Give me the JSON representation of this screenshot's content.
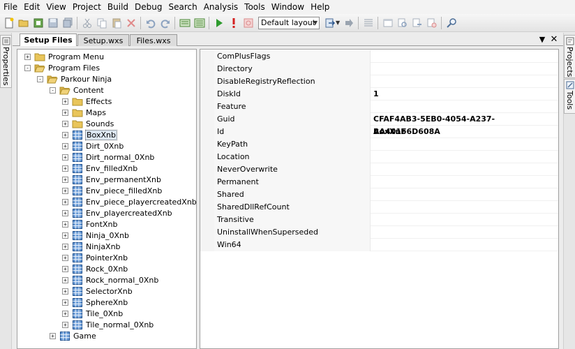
{
  "menu": [
    "File",
    "Edit",
    "View",
    "Project",
    "Build",
    "Debug",
    "Search",
    "Analysis",
    "Tools",
    "Window",
    "Help"
  ],
  "toolbar": {
    "layout_value": "Default layout"
  },
  "left_strip": {
    "properties_label": "Properties"
  },
  "right_strip": {
    "projects_label": "Projects",
    "tools_label": "Tools"
  },
  "tabs": [
    {
      "label": "Setup Files",
      "active": true
    },
    {
      "label": "Setup.wxs",
      "active": false
    },
    {
      "label": "Files.wxs",
      "active": false
    }
  ],
  "tree": [
    {
      "label": "Program Menu",
      "depth": 0,
      "icon": "folder-icon",
      "expander": "+"
    },
    {
      "label": "Program Files",
      "depth": 0,
      "icon": "folder-open-icon",
      "expander": "-"
    },
    {
      "label": "Parkour Ninja",
      "depth": 1,
      "icon": "folder-open-icon",
      "expander": "-"
    },
    {
      "label": "Content",
      "depth": 2,
      "icon": "folder-open-icon",
      "expander": "-"
    },
    {
      "label": "Effects",
      "depth": 3,
      "icon": "folder-icon",
      "expander": "+"
    },
    {
      "label": "Maps",
      "depth": 3,
      "icon": "folder-icon",
      "expander": "+"
    },
    {
      "label": "Sounds",
      "depth": 3,
      "icon": "folder-icon",
      "expander": "+"
    },
    {
      "label": "BoxXnb",
      "depth": 3,
      "icon": "component-icon",
      "expander": "+",
      "selected": true
    },
    {
      "label": "Dirt_0Xnb",
      "depth": 3,
      "icon": "component-icon",
      "expander": "+"
    },
    {
      "label": "Dirt_normal_0Xnb",
      "depth": 3,
      "icon": "component-icon",
      "expander": "+"
    },
    {
      "label": "Env_filledXnb",
      "depth": 3,
      "icon": "component-icon",
      "expander": "+"
    },
    {
      "label": "Env_permanentXnb",
      "depth": 3,
      "icon": "component-icon",
      "expander": "+"
    },
    {
      "label": "Env_piece_filledXnb",
      "depth": 3,
      "icon": "component-icon",
      "expander": "+"
    },
    {
      "label": "Env_piece_playercreatedXnb",
      "depth": 3,
      "icon": "component-icon",
      "expander": "+"
    },
    {
      "label": "Env_playercreatedXnb",
      "depth": 3,
      "icon": "component-icon",
      "expander": "+"
    },
    {
      "label": "FontXnb",
      "depth": 3,
      "icon": "component-icon",
      "expander": "+"
    },
    {
      "label": "Ninja_0Xnb",
      "depth": 3,
      "icon": "component-icon",
      "expander": "+"
    },
    {
      "label": "NinjaXnb",
      "depth": 3,
      "icon": "component-icon",
      "expander": "+"
    },
    {
      "label": "PointerXnb",
      "depth": 3,
      "icon": "component-icon",
      "expander": "+"
    },
    {
      "label": "Rock_0Xnb",
      "depth": 3,
      "icon": "component-icon",
      "expander": "+"
    },
    {
      "label": "Rock_normal_0Xnb",
      "depth": 3,
      "icon": "component-icon",
      "expander": "+"
    },
    {
      "label": "SelectorXnb",
      "depth": 3,
      "icon": "component-icon",
      "expander": "+"
    },
    {
      "label": "SphereXnb",
      "depth": 3,
      "icon": "component-icon",
      "expander": "+"
    },
    {
      "label": "Tile_0Xnb",
      "depth": 3,
      "icon": "component-icon",
      "expander": "+"
    },
    {
      "label": "Tile_normal_0Xnb",
      "depth": 3,
      "icon": "component-icon",
      "expander": "+"
    },
    {
      "label": "Game",
      "depth": 2,
      "icon": "component-icon",
      "expander": "+"
    }
  ],
  "properties": [
    {
      "name": "ComPlusFlags",
      "value": ""
    },
    {
      "name": "Directory",
      "value": ""
    },
    {
      "name": "DisableRegistryReflection",
      "value": ""
    },
    {
      "name": "DiskId",
      "value": "1"
    },
    {
      "name": "Feature",
      "value": ""
    },
    {
      "name": "Guid",
      "value": "CFAF4AB3-5EB0-4054-A237-AA401F6D608A"
    },
    {
      "name": "Id",
      "value": "BoxXnb"
    },
    {
      "name": "KeyPath",
      "value": ""
    },
    {
      "name": "Location",
      "value": ""
    },
    {
      "name": "NeverOverwrite",
      "value": ""
    },
    {
      "name": "Permanent",
      "value": ""
    },
    {
      "name": "Shared",
      "value": ""
    },
    {
      "name": "SharedDllRefCount",
      "value": ""
    },
    {
      "name": "Transitive",
      "value": ""
    },
    {
      "name": "UninstallWhenSuperseded",
      "value": ""
    },
    {
      "name": "Win64",
      "value": ""
    }
  ],
  "colors": {
    "folder": "#e9c55a",
    "component": "#2f6db4",
    "play": "#2e9b2e",
    "stop": "#d42020",
    "selection_bg": "#dde8f3"
  }
}
